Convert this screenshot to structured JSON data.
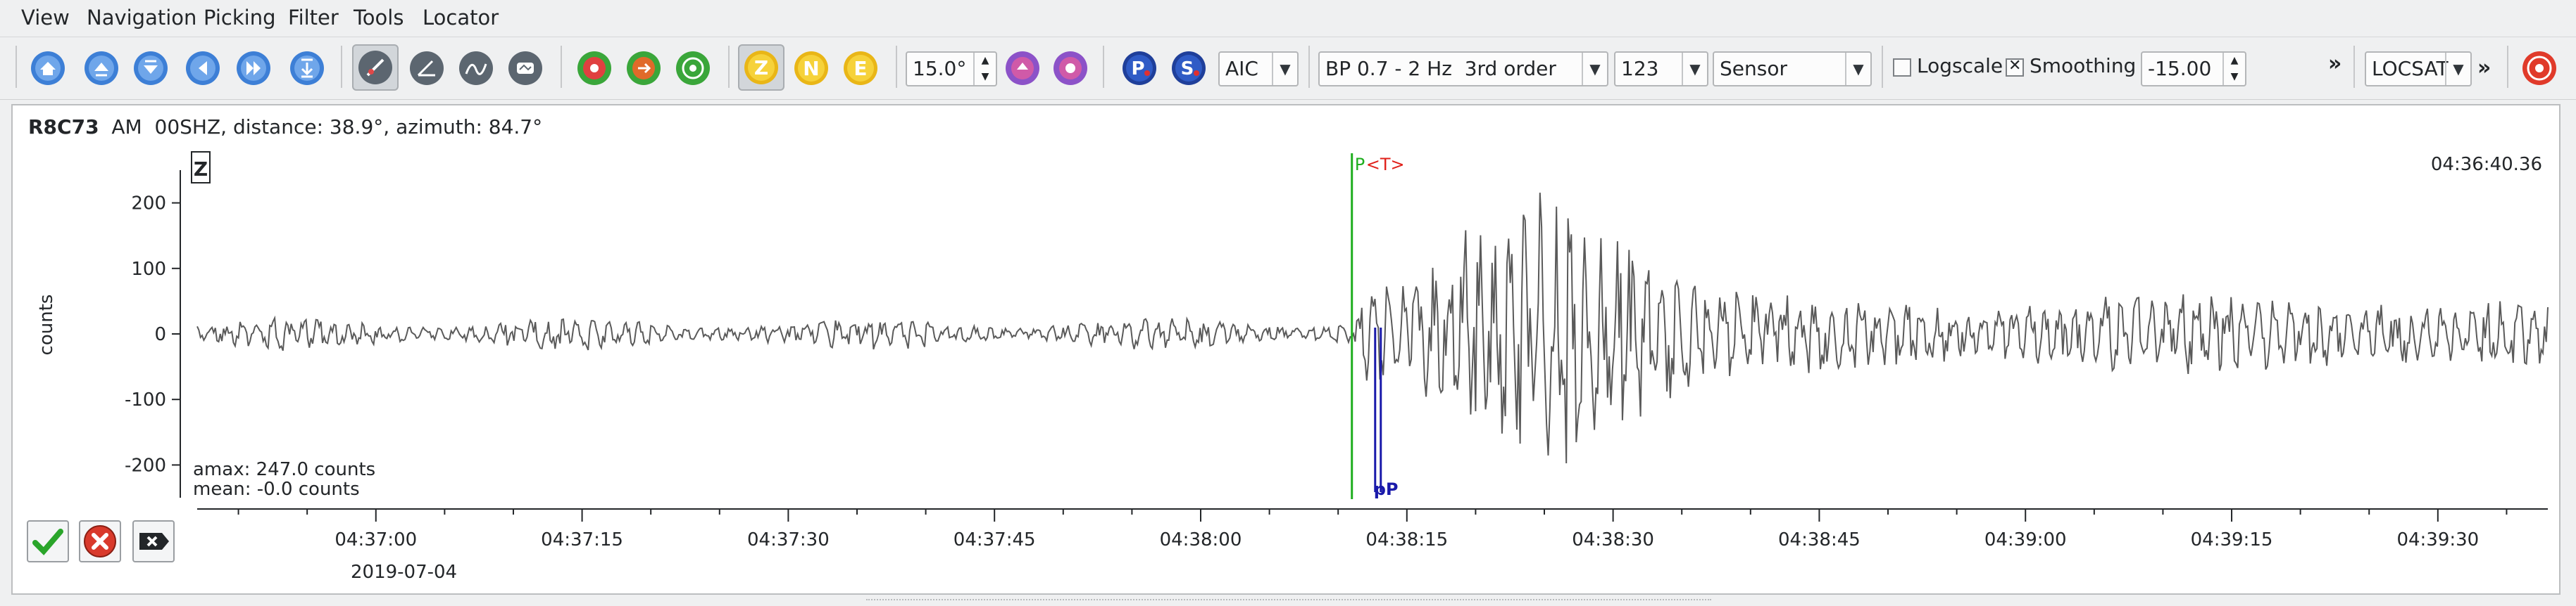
{
  "menu": [
    "View",
    "Navigation",
    "Picking",
    "Filter",
    "Tools",
    "Locator"
  ],
  "toolbar": {
    "component_buttons": [
      "Z",
      "N",
      "E"
    ],
    "rotation_value": "15.0°",
    "picker_method": "AIC",
    "pick_buttons": [
      "P",
      "S"
    ],
    "filter": "BP 0.7 - 2 Hz  3rd order",
    "channels": "123",
    "unit_mode": "Sensor",
    "logscale_label": "Logscale",
    "logscale_checked": false,
    "smoothing_label": "Smoothing",
    "smoothing_checked": true,
    "smoothing_value": "-15.00",
    "more": "»",
    "locator": "LOCSAT",
    "more2": "»"
  },
  "trace": {
    "station": "R8C73",
    "network": "AM",
    "channel": "00SHZ, distance: 38.9°, azimuth: 84.7°",
    "component_box": "Z",
    "time_right": "04:36:40.36",
    "pick_label_p": "P",
    "pick_label_t": "<T>",
    "pick_label_bottom": "pP",
    "amax": "amax: 247.0 counts",
    "mean": "mean: -0.0 counts",
    "date": "2019-07-04"
  },
  "chart_data": {
    "type": "line",
    "ylabel": "counts",
    "ylim": [
      -250,
      250
    ],
    "yticks": [
      200,
      100,
      0,
      -100,
      -200
    ],
    "xticks": [
      "04:37:00",
      "04:37:15",
      "04:37:30",
      "04:37:45",
      "04:38:00",
      "04:38:15",
      "04:38:30",
      "04:38:45",
      "04:39:00",
      "04:39:15",
      "04:39:30"
    ],
    "x_start": "04:36:47",
    "x_end": "04:39:38",
    "pick_p_time": "04:38:11",
    "pick_pp_time": "04:38:13"
  },
  "colors": {
    "pick_green": "#1fae1f",
    "pick_red": "#e0201a",
    "pick_blue": "#1a1aaa",
    "trace_gray": "#5a5a5a"
  }
}
